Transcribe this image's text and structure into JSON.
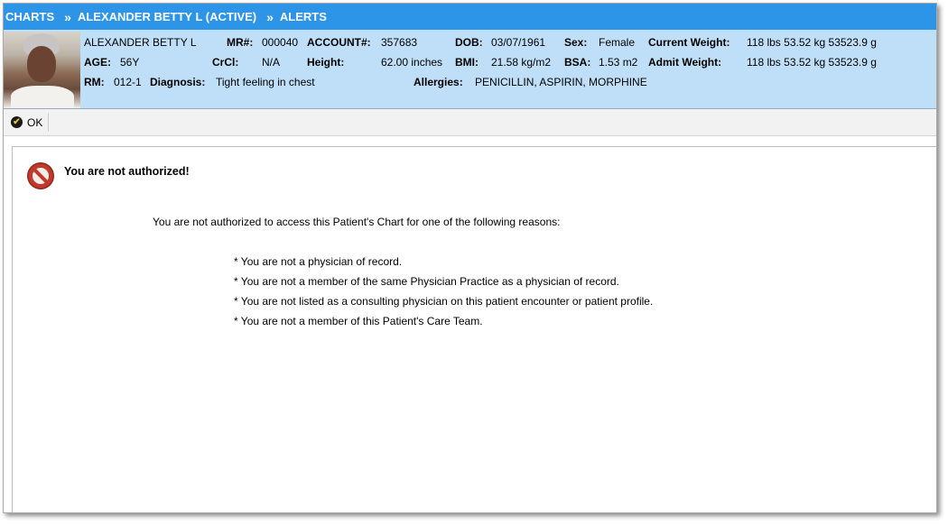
{
  "breadcrumb": {
    "items": [
      "CHARTS",
      "ALEXANDER BETTY L (ACTIVE)",
      "ALERTS"
    ],
    "separator": "»"
  },
  "patient": {
    "name": "ALEXANDER BETTY L",
    "mr_label": "MR#:",
    "mr": "000040",
    "account_label": "ACCOUNT#:",
    "account": "357683",
    "dob_label": "DOB:",
    "dob": "03/07/1961",
    "sex_label": "Sex:",
    "sex": "Female",
    "current_weight_label": "Current Weight:",
    "current_weight": "118 lbs 53.52 kg 53523.9 g",
    "age_label": "AGE:",
    "age": "56Y",
    "crcl_label": "CrCl:",
    "crcl": "N/A",
    "height_label": "Height:",
    "height": "62.00 inches",
    "bmi_label": "BMI:",
    "bmi": "21.58 kg/m2",
    "bsa_label": "BSA:",
    "bsa": "1.53 m2",
    "admit_weight_label": "Admit Weight:",
    "admit_weight": "118 lbs 53.52 kg 53523.9 g",
    "rm_label": "RM:",
    "rm": "012-1",
    "diagnosis_label": "Diagnosis:",
    "diagnosis": "Tight feeling in chest",
    "allergies_label": "Allergies:",
    "allergies": "PENICILLIN, ASPIRIN, MORPHINE"
  },
  "toolbar": {
    "ok_label": "OK"
  },
  "alert": {
    "title": "You are not authorized!",
    "intro": "You are not authorized to access this Patient's Chart for one of the following reasons:",
    "reasons": [
      "* You are not a physician of record.",
      "* You are not a member of the same Physician Practice as a physician of record.",
      "* You are not listed as a consulting physician on this patient encounter or patient profile.",
      "* You are not a member of this Patient's Care Team."
    ]
  },
  "colors": {
    "breadcrumb_bg": "#2d95e8",
    "patient_bg": "#bfdff8",
    "noentry_red": "#c0392b"
  }
}
